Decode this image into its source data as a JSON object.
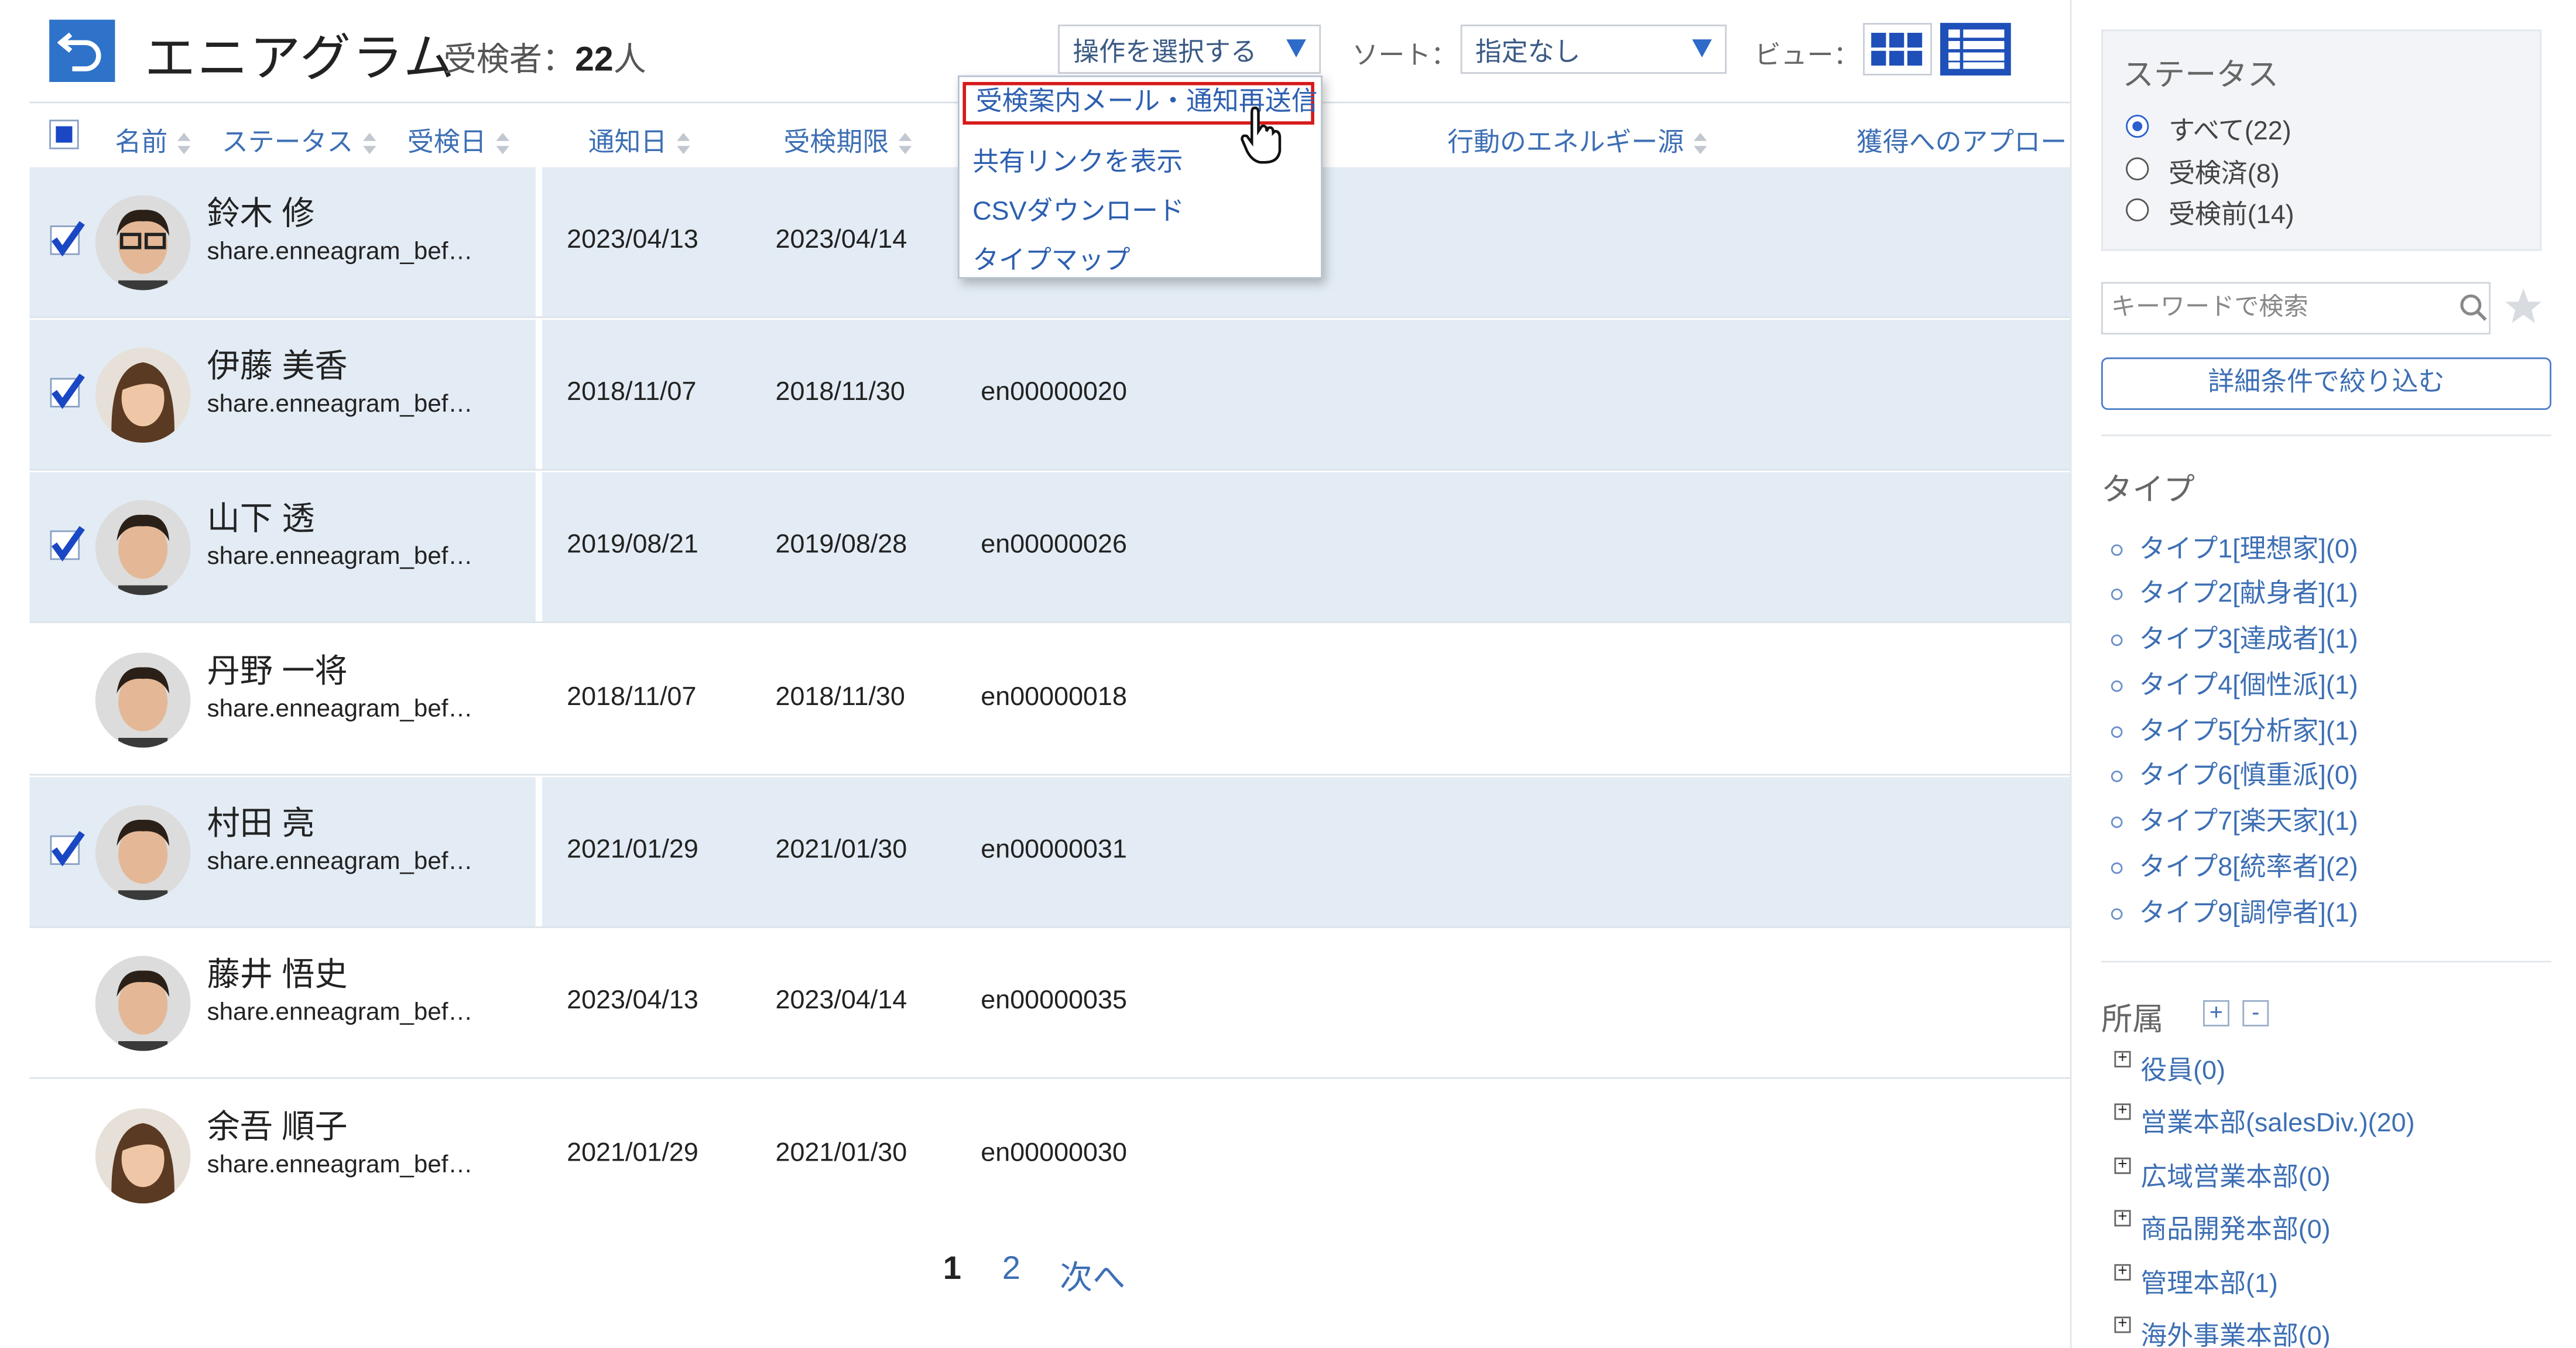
{
  "header": {
    "title": "エニアグラム",
    "count_label": "受検者：",
    "count_value": "22",
    "count_unit": "人",
    "action_select": "操作を選択する",
    "sort_label": "ソート：",
    "sort_value": "指定なし",
    "view_label": "ビュー：",
    "icons": {
      "back": "back-arrow-icon",
      "grid": "grid-view-icon",
      "list": "list-view-icon"
    }
  },
  "table": {
    "columns": [
      "名前",
      "ステータス",
      "受検日",
      "通知日",
      "受検期限",
      "行動のエネルギー源",
      "獲得へのアプロー"
    ],
    "rows": [
      {
        "name": "鈴木 修",
        "email": "share.enneagram_bef…",
        "notify": "2023/04/13",
        "deadline": "2023/04/14",
        "id": "",
        "checked": true
      },
      {
        "name": "伊藤 美香",
        "email": "share.enneagram_bef…",
        "notify": "2018/11/07",
        "deadline": "2018/11/30",
        "id": "en00000020",
        "checked": true
      },
      {
        "name": "山下 透",
        "email": "share.enneagram_bef…",
        "notify": "2019/08/21",
        "deadline": "2019/08/28",
        "id": "en00000026",
        "checked": true
      },
      {
        "name": "丹野 一将",
        "email": "share.enneagram_bef…",
        "notify": "2018/11/07",
        "deadline": "2018/11/30",
        "id": "en00000018",
        "checked": false
      },
      {
        "name": "村田 亮",
        "email": "share.enneagram_bef…",
        "notify": "2021/01/29",
        "deadline": "2021/01/30",
        "id": "en00000031",
        "checked": true
      },
      {
        "name": "藤井 悟史",
        "email": "share.enneagram_bef…",
        "notify": "2023/04/13",
        "deadline": "2023/04/14",
        "id": "en00000035",
        "checked": false
      },
      {
        "name": "余吾 順子",
        "email": "share.enneagram_bef…",
        "notify": "2021/01/29",
        "deadline": "2021/01/30",
        "id": "en00000030",
        "checked": false
      }
    ]
  },
  "dropdown": {
    "items": [
      "受検案内メール・通知再送信",
      "共有リンクを表示",
      "CSVダウンロード",
      "タイプマップ"
    ]
  },
  "pager": {
    "current": "1",
    "page2": "2",
    "next": "次へ"
  },
  "sidebar": {
    "status_title": "ステータス",
    "status_options": [
      "すべて(22)",
      "受検済(8)",
      "受検前(14)"
    ],
    "search_placeholder": "キーワードで検索",
    "filter_button": "詳細条件で絞り込む",
    "type_title": "タイプ",
    "types": [
      "タイプ1[理想家](0)",
      "タイプ2[献身者](1)",
      "タイプ3[達成者](1)",
      "タイプ4[個性派](1)",
      "タイプ5[分析家](1)",
      "タイプ6[慎重派](0)",
      "タイプ7[楽天家](1)",
      "タイプ8[統率者](2)",
      "タイプ9[調停者](1)"
    ],
    "org_title": "所属",
    "orgs": [
      "役員(0)",
      "営業本部(salesDiv.)(20)",
      "広域営業本部(0)",
      "商品開発本部(0)",
      "管理本部(1)",
      "海外事業本部(0)"
    ]
  },
  "colors": {
    "accent": "#2e73c9",
    "selected_row": "#e3ecf4",
    "highlight": "#d61a1a",
    "link": "#3d6fb4"
  }
}
